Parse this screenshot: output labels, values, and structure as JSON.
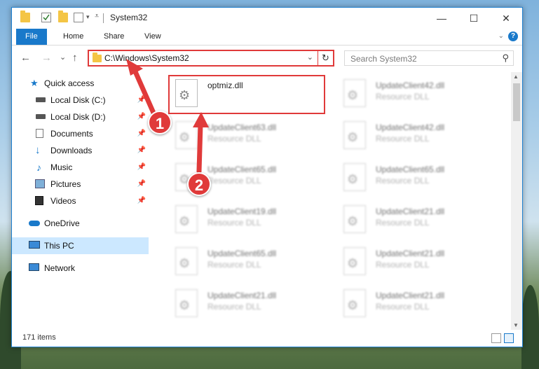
{
  "window": {
    "title": "System32",
    "controls": {
      "minimize": "—",
      "maximize": "☐",
      "close": "✕"
    }
  },
  "ribbon": {
    "tabs": [
      "File",
      "Home",
      "Share",
      "View"
    ],
    "help": "?"
  },
  "nav": {
    "back": "←",
    "forward": "→",
    "recent": "⌄",
    "up": "↑",
    "address": "C:\\Windows\\System32",
    "refresh": "↻",
    "search_placeholder": "Search System32"
  },
  "sidebar": {
    "items": [
      {
        "label": "Quick access",
        "icon": "star-icon",
        "pinned": false
      },
      {
        "label": "Local Disk (C:)",
        "icon": "drive-icon",
        "pinned": true
      },
      {
        "label": "Local Disk (D:)",
        "icon": "drive-icon",
        "pinned": true
      },
      {
        "label": "Documents",
        "icon": "documents-icon",
        "pinned": true
      },
      {
        "label": "Downloads",
        "icon": "download-icon",
        "pinned": true
      },
      {
        "label": "Music",
        "icon": "music-icon",
        "pinned": true
      },
      {
        "label": "Pictures",
        "icon": "pictures-icon",
        "pinned": true
      },
      {
        "label": "Videos",
        "icon": "videos-icon",
        "pinned": true
      },
      {
        "label": "OneDrive",
        "icon": "cloud-icon",
        "pinned": false
      },
      {
        "label": "This PC",
        "icon": "computer-icon",
        "pinned": false,
        "selected": true
      },
      {
        "label": "Network",
        "icon": "network-icon",
        "pinned": false
      }
    ]
  },
  "files": [
    {
      "name": "optmiz.dll",
      "desc": "",
      "highlight": true
    },
    {
      "name": "UpdateClient42.dll",
      "desc": "Resource DLL"
    },
    {
      "name": "UpdateClient63.dll",
      "desc": "Resource DLL"
    },
    {
      "name": "UpdateClient42.dll",
      "desc": "Resource DLL"
    },
    {
      "name": "UpdateClient65.dll",
      "desc": "Resource DLL"
    },
    {
      "name": "UpdateClient65.dll",
      "desc": "Resource DLL"
    },
    {
      "name": "UpdateClient19.dll",
      "desc": "Resource DLL"
    },
    {
      "name": "UpdateClient21.dll",
      "desc": "Resource DLL"
    },
    {
      "name": "UpdateClient65.dll",
      "desc": "Resource DLL"
    },
    {
      "name": "UpdateClient21.dll",
      "desc": "Resource DLL"
    },
    {
      "name": "UpdateClient21.dll",
      "desc": "Resource DLL"
    },
    {
      "name": "UpdateClient21.dll",
      "desc": "Resource DLL"
    }
  ],
  "status": {
    "count": "171 items"
  },
  "annotations": {
    "step1": "1",
    "step2": "2"
  },
  "colors": {
    "accent": "#1979ca",
    "annotation": "#e03a3a",
    "selection": "#cce8ff"
  }
}
